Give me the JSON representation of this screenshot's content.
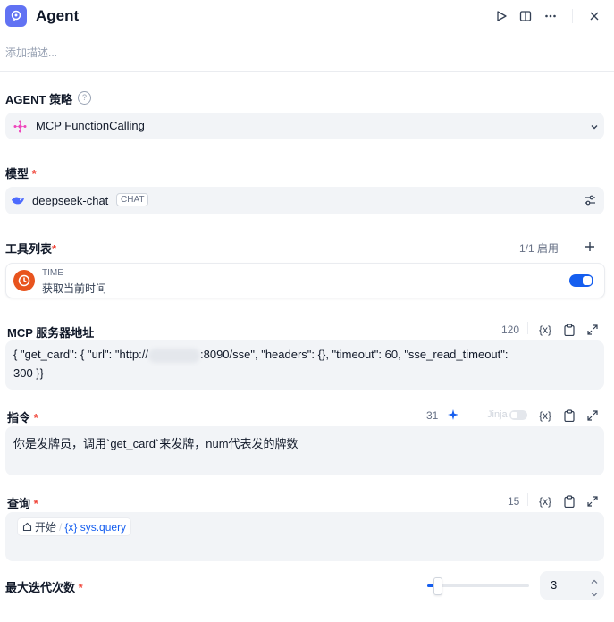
{
  "header": {
    "title": "Agent",
    "description_placeholder": "添加描述..."
  },
  "strategy": {
    "label": "AGENT 策略",
    "value": "MCP FunctionCalling"
  },
  "model": {
    "label": "模型",
    "required_mark": "*",
    "name": "deepseek-chat",
    "badge": "CHAT"
  },
  "tools": {
    "label": "工具列表",
    "required_mark": "*",
    "count": "1/1 启用",
    "items": [
      {
        "provider": "TIME",
        "name": "获取当前时间",
        "enabled": true
      }
    ]
  },
  "mcp": {
    "label": "MCP 服务器地址",
    "count": "120",
    "var_glyph": "{x}",
    "line1_prefix": "{  \"get_card\": {     \"url\": \"http://",
    "line1_suffix": ":8090/sse\",     \"headers\": {}, \"timeout\": 60,     \"sse_read_timeout\":",
    "line2": "300  }}"
  },
  "instruction": {
    "label": "指令",
    "required_mark": "*",
    "count": "31",
    "jinja_label": "Jinja",
    "var_glyph": "{x}",
    "text": "你是发牌员，调用`get_card`来发牌，num代表发的牌数"
  },
  "query": {
    "label": "查询",
    "required_mark": "*",
    "count": "15",
    "var_glyph": "{x}",
    "node": "开始",
    "separator": "/",
    "variable": "{x} sys.query"
  },
  "iterations": {
    "label": "最大迭代次数",
    "required_mark": "*",
    "value": "3",
    "slider_fraction": 0.1
  },
  "colors": {
    "accent": "#155eef",
    "field_bg": "#f2f4f7",
    "required": "#f04438",
    "time_icon": "#e8541e"
  }
}
